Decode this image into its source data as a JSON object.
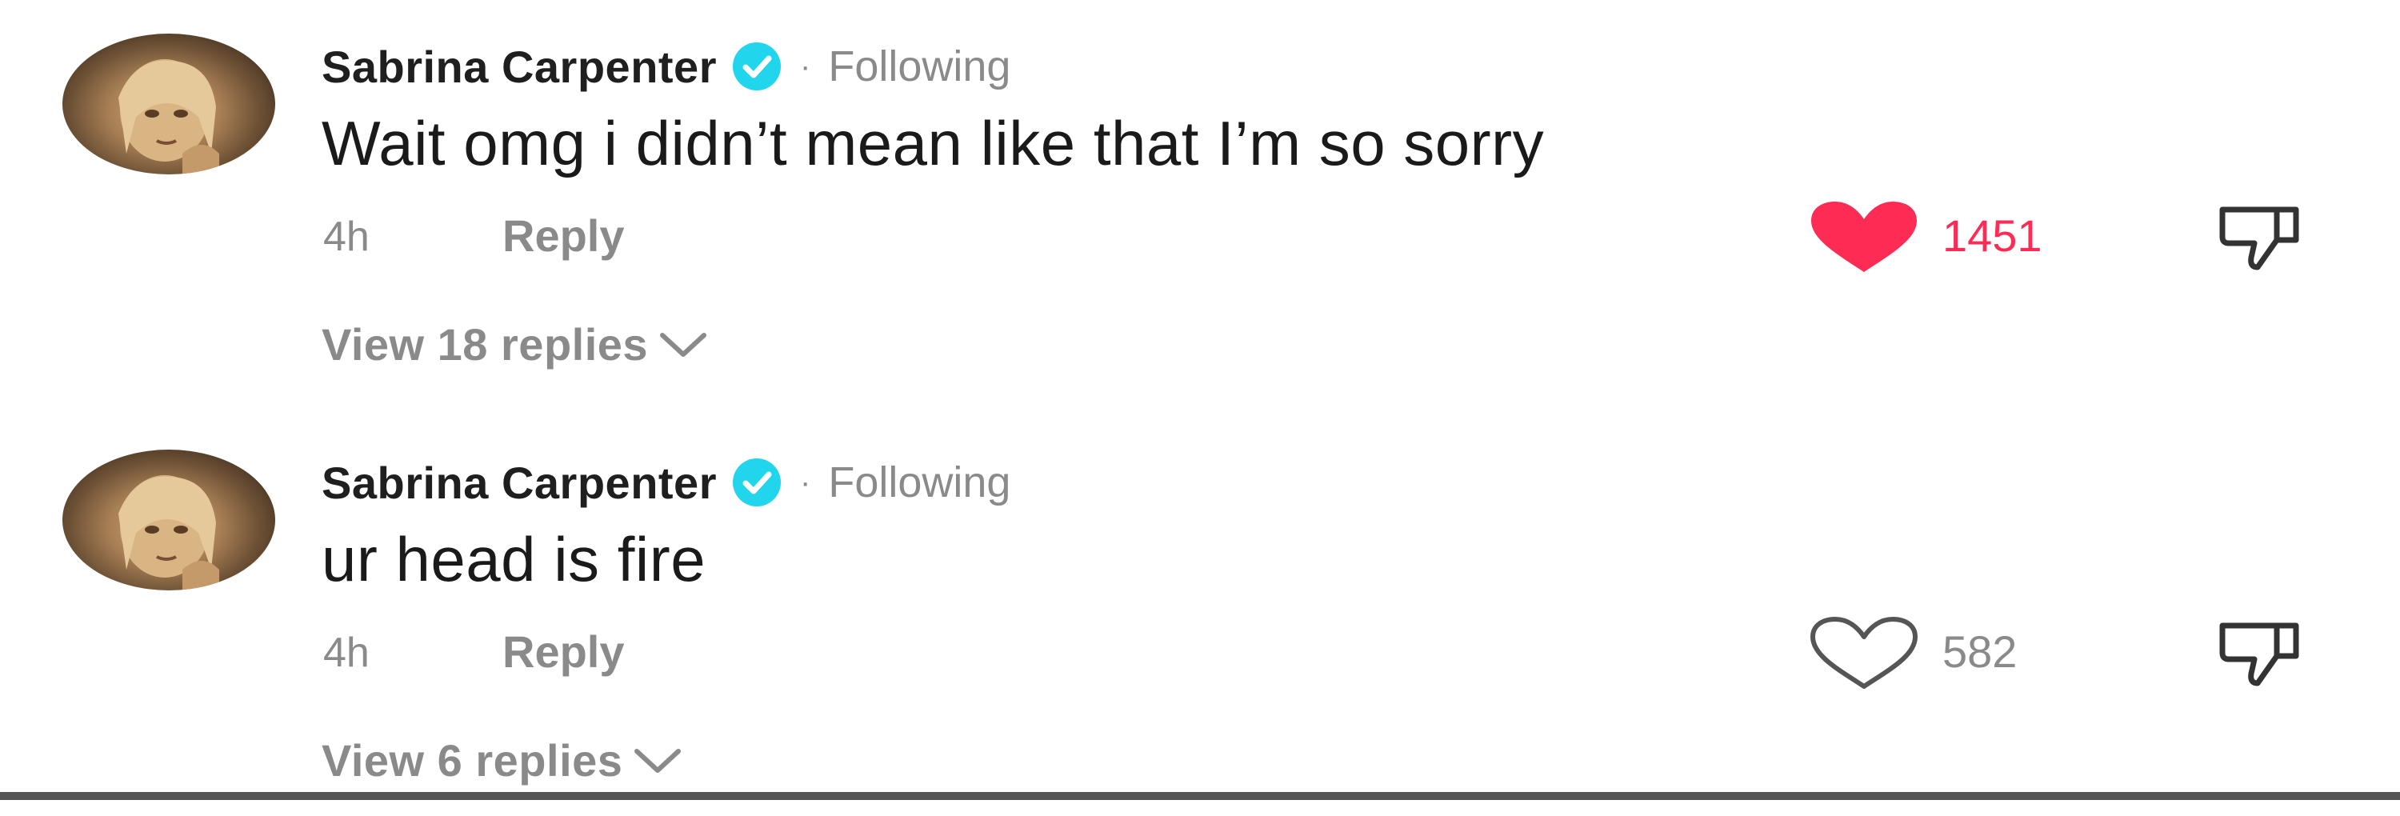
{
  "comments": [
    {
      "username": "Sabrina Carpenter",
      "separator": "·",
      "follow_status": "Following",
      "text": "Wait omg i didn’t mean like that I’m so sorry",
      "time": "4h",
      "reply_label": "Reply",
      "likes": "1451",
      "liked": true,
      "view_replies_label": "View 18 replies"
    },
    {
      "username": "Sabrina Carpenter",
      "separator": "·",
      "follow_status": "Following",
      "text": "ur head is fire",
      "time": "4h",
      "reply_label": "Reply",
      "likes": "582",
      "liked": false,
      "view_replies_label": "View 6 replies"
    }
  ],
  "icons": {
    "verified": "verified-badge-icon",
    "like": "heart-icon",
    "dislike": "thumbs-down-icon",
    "expand": "chevron-down-icon"
  },
  "colors": {
    "liked": "#fe2c55",
    "verified": "#20d5ec",
    "muted": "#8a8a8a",
    "text": "#1a1a1a"
  }
}
